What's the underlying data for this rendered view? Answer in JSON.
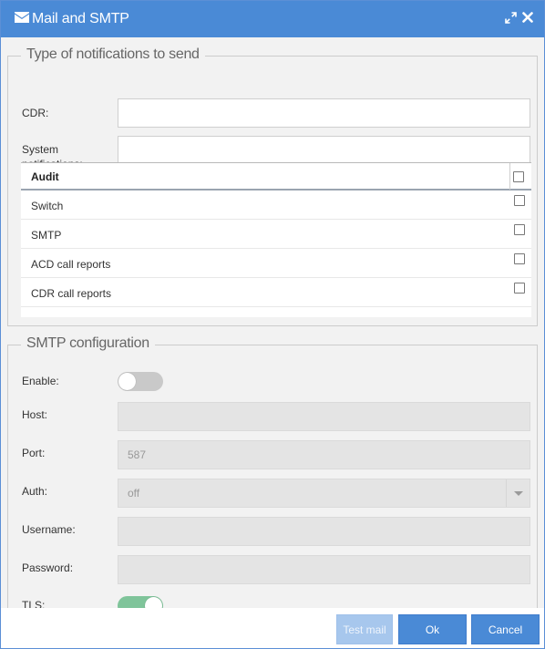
{
  "window": {
    "title": "Mail and SMTP",
    "icons": {
      "title": "mail-icon",
      "expand": "expand-icon",
      "close": "close-icon"
    },
    "accent_color": "#4a8ad6"
  },
  "notifications": {
    "legend": "Type of notifications to send",
    "cdr": {
      "label": "CDR:",
      "value": ""
    },
    "system": {
      "label": "System notifications:",
      "value": ""
    },
    "table": {
      "header": "Audit",
      "header_checked": false,
      "rows": [
        {
          "label": "Switch",
          "checked": false
        },
        {
          "label": "SMTP",
          "checked": false
        },
        {
          "label": "ACD call reports",
          "checked": false
        },
        {
          "label": "CDR call reports",
          "checked": false
        }
      ]
    }
  },
  "smtp": {
    "legend": "SMTP configuration",
    "enable": {
      "label": "Enable:",
      "on": false
    },
    "host": {
      "label": "Host:",
      "value": ""
    },
    "port": {
      "label": "Port:",
      "value": "587"
    },
    "auth": {
      "label": "Auth:",
      "value": "off"
    },
    "username": {
      "label": "Username:",
      "value": ""
    },
    "password": {
      "label": "Password:",
      "value": ""
    },
    "tls": {
      "label": "TLS:",
      "on": true
    }
  },
  "footer": {
    "test_mail": "Test mail",
    "ok": "Ok",
    "cancel": "Cancel"
  }
}
